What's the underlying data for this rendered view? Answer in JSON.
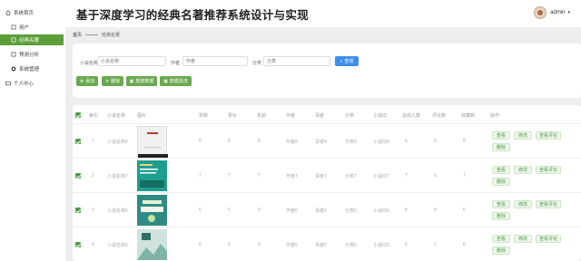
{
  "sidebar": {
    "items": [
      {
        "label": "系统首页",
        "icon": "home-icon"
      },
      {
        "label": "用户",
        "icon": "user-icon"
      },
      {
        "label": "经典名著",
        "icon": "book-icon"
      },
      {
        "label": "预测分析",
        "icon": "chart-icon"
      },
      {
        "label": "系统管理",
        "icon": "gear-icon"
      },
      {
        "label": "个人中心",
        "icon": "profile-icon"
      }
    ]
  },
  "header": {
    "title": "基于深度学习的经典名著推荐系统设计与实现",
    "user": "admin"
  },
  "breadcrumb": {
    "home": "首页",
    "current": "经典名著"
  },
  "search": {
    "name_label": "小说名称",
    "name_placeholder": "小说名称",
    "author_label": "作者",
    "author_placeholder": "作者",
    "category_label": "分类",
    "category_placeholder": "分类",
    "search_button": "查询"
  },
  "actions": {
    "add": "添加",
    "delete": "删除",
    "crawl": "爬取数据",
    "clean": "数据清洗"
  },
  "table": {
    "headers": [
      "索引",
      "小说名称",
      "图片",
      "票数",
      "票价",
      "年龄",
      "作者",
      "译者",
      "分类",
      "小说ID",
      "总收入数",
      "评论数",
      "收藏数",
      "操作"
    ],
    "row_actions": {
      "view": "查看",
      "edit": "修改",
      "view_comments": "查看评论",
      "delete": "删除"
    },
    "rows": [
      {
        "index": "1",
        "name": "小说名称8",
        "votes": "8",
        "price": "8",
        "age": "8",
        "author": "作者8",
        "translator": "译者8",
        "category": "分类8",
        "novel_id": "小说ID8",
        "income": "8",
        "comments": "0",
        "favorites": "8"
      },
      {
        "index": "2",
        "name": "小说名称7",
        "votes": "7",
        "price": "7",
        "age": "7",
        "author": "作者7",
        "translator": "译者7",
        "category": "分类7",
        "novel_id": "小说ID7",
        "income": "7",
        "comments": "0",
        "favorites": "7"
      },
      {
        "index": "3",
        "name": "小说名称6",
        "votes": "6",
        "price": "6",
        "age": "6",
        "author": "作者6",
        "translator": "译者6",
        "category": "分类6",
        "novel_id": "小说ID6",
        "income": "6",
        "comments": "0",
        "favorites": "6"
      },
      {
        "index": "4",
        "name": "小说名称5",
        "votes": "5",
        "price": "5",
        "age": "5",
        "author": "作者5",
        "translator": "译者5",
        "category": "分类5",
        "novel_id": "小说ID5",
        "income": "5",
        "comments": "1",
        "favorites": "6"
      }
    ]
  },
  "colors": {
    "accent_green": "#5c9e3a",
    "button_blue": "#3d8ee8"
  }
}
